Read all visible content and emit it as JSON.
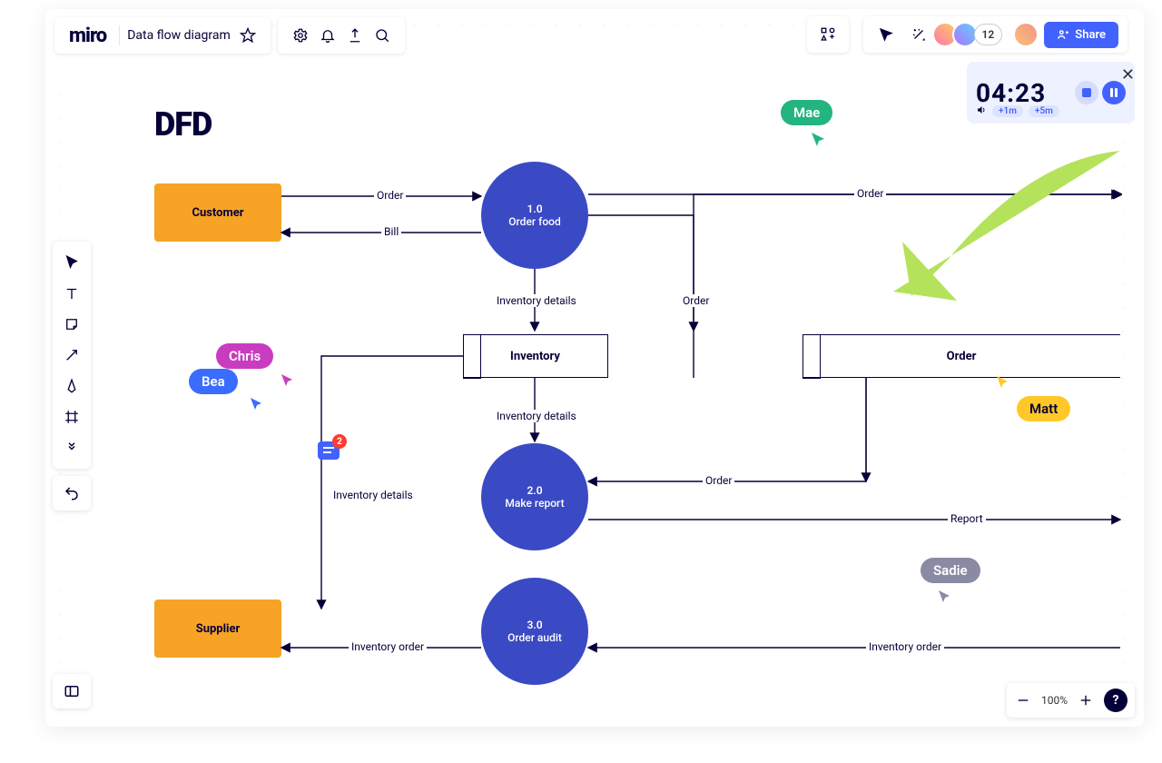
{
  "app": {
    "logo": "miro"
  },
  "board": {
    "name": "Data flow diagram"
  },
  "share": {
    "label": "Share"
  },
  "presence": {
    "extra_count": "12"
  },
  "timer": {
    "display": "04:23",
    "add1": "+1m",
    "add5": "+5m"
  },
  "zoom": {
    "pct": "100%"
  },
  "canvas": {
    "title": "DFD",
    "entities": {
      "customer": "Customer",
      "supplier": "Supplier"
    },
    "processes": {
      "p1": {
        "num": "1.0",
        "name": "Order food"
      },
      "p2": {
        "num": "2.0",
        "name": "Make report"
      },
      "p3": {
        "num": "3.0",
        "name": "Order audit"
      }
    },
    "stores": {
      "inventory": "Inventory",
      "order": "Order"
    },
    "flows": {
      "order": "Order",
      "bill": "Bill",
      "inv_details": "Inventory details",
      "report": "Report",
      "inv_order": "Inventory order"
    },
    "cursors": {
      "mae": "Mae",
      "chris": "Chris",
      "bea": "Bea",
      "matt": "Matt",
      "sadie": "Sadie"
    },
    "comment_count": "2"
  }
}
